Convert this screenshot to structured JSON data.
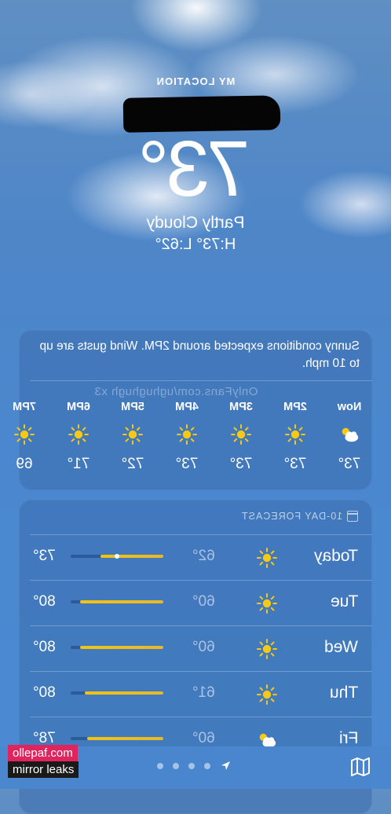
{
  "status_bar": {
    "left": "",
    "right": ""
  },
  "location": {
    "label": "MY LOCATION"
  },
  "current": {
    "temp": "73°",
    "condition": "Partly Cloudy",
    "hilo": "H:73° L:62°"
  },
  "hourly": {
    "summary": "Sunny conditions expected around 2PM. Wind gusts are up to 10 mph.",
    "watermark": "OnlyFans.com/ughughugh x3",
    "hours": [
      {
        "label": "Now",
        "temp": "73°",
        "icon": "partly-cloudy-icon"
      },
      {
        "label": "2PM",
        "temp": "73°",
        "icon": "sun-icon"
      },
      {
        "label": "3PM",
        "temp": "73°",
        "icon": "sun-icon"
      },
      {
        "label": "4PM",
        "temp": "73°",
        "icon": "sun-icon"
      },
      {
        "label": "5PM",
        "temp": "72°",
        "icon": "sun-icon"
      },
      {
        "label": "6PM",
        "temp": "71°",
        "icon": "sun-icon"
      },
      {
        "label": "7PM",
        "temp": "69",
        "icon": "sun-icon"
      }
    ]
  },
  "daily": {
    "header": "10-DAY FORECAST",
    "days": [
      {
        "name": "Today",
        "low": "62°",
        "high": "73°",
        "icon": "sun-icon",
        "bar_start": 0.0,
        "bar_end": 0.68,
        "current": 0.5
      },
      {
        "name": "Tue",
        "low": "60°",
        "high": "80°",
        "icon": "sun-icon",
        "bar_start": 0.0,
        "bar_end": 0.9,
        "current": null
      },
      {
        "name": "Wed",
        "low": "60°",
        "high": "80°",
        "icon": "sun-icon",
        "bar_start": 0.0,
        "bar_end": 0.9,
        "current": null
      },
      {
        "name": "Thu",
        "low": "61°",
        "high": "80°",
        "icon": "sun-icon",
        "bar_start": 0.0,
        "bar_end": 0.85,
        "current": null
      },
      {
        "name": "Fri",
        "low": "60°",
        "high": "78°",
        "icon": "partly-cloudy-icon",
        "bar_start": 0.0,
        "bar_end": 0.82,
        "current": null
      }
    ]
  },
  "nav": {
    "pages": 4,
    "location_icon": "location-arrow-icon",
    "map_icon": "map-icon"
  },
  "overlay": {
    "line1": "ollepaf.com",
    "line2": "mirror leaks"
  }
}
